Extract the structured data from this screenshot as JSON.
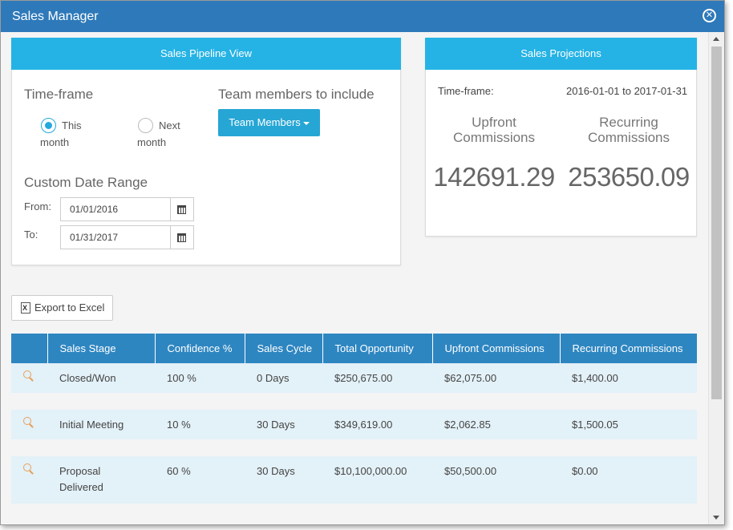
{
  "window": {
    "title": "Sales Manager"
  },
  "pipeline": {
    "header": "Sales Pipeline View",
    "timeframe_label": "Time-frame",
    "radio_this": {
      "line1": "This",
      "line2": "month",
      "checked": true
    },
    "radio_next": {
      "line1": "Next",
      "line2": "month",
      "checked": false
    },
    "team_label": "Team members to include",
    "team_button": "Team Members",
    "custom_label": "Custom Date Range",
    "from_label": "From:",
    "from_value": "01/01/2016",
    "to_label": "To:",
    "to_value": "01/31/2017"
  },
  "projections": {
    "header": "Sales Projections",
    "timeframe_label": "Time-frame:",
    "timeframe_value": "2016-01-01 to 2017-01-31",
    "upfront_line1": "Upfront",
    "upfront_line2": "Commissions",
    "recurring_line1": "Recurring",
    "recurring_line2": "Commissions",
    "upfront_value": "142691.29",
    "recurring_value": "253650.09"
  },
  "export_button": "Export to Excel",
  "table": {
    "columns": [
      "",
      "Sales Stage",
      "Confidence %",
      "Sales Cycle",
      "Total Opportunity",
      "Upfront Commissions",
      "Recurring Commissions"
    ],
    "rows": [
      {
        "stage1": "Closed/Won",
        "stage2": "",
        "confidence": "100 %",
        "cycle": "0 Days",
        "total": "$250,675.00",
        "upfront": "$62,075.00",
        "recurring": "$1,400.00"
      },
      {
        "stage1": "Initial Meeting",
        "stage2": "",
        "confidence": "10 %",
        "cycle": "30 Days",
        "total": "$349,619.00",
        "upfront": "$2,062.85",
        "recurring": "$1,500.05"
      },
      {
        "stage1": "Proposal",
        "stage2": "Delivered",
        "confidence": "60 %",
        "cycle": "30 Days",
        "total": "$10,100,000.00",
        "upfront": "$50,500.00",
        "recurring": "$0.00"
      }
    ]
  },
  "colors": {
    "titlebar": "#2e79b9",
    "panel_header": "#25b3e5",
    "table_header": "#2e86c1",
    "row_bg": "#e3f1f8",
    "accent": "#26a6d4",
    "search_icon": "#e8a05b"
  }
}
